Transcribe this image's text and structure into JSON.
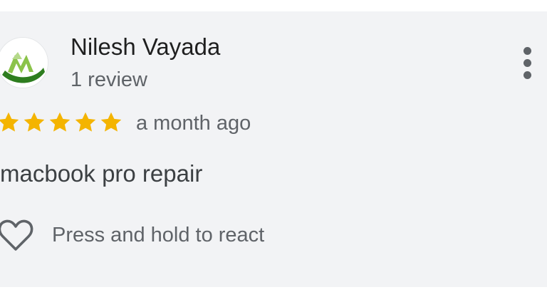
{
  "review": {
    "reviewer_name": "Nilesh Vayada",
    "review_count": "1 review",
    "rating": 5,
    "rating_max": 5,
    "time_ago": "a month ago",
    "text": "macbook pro repair",
    "react_label": "Press and hold to react"
  },
  "icons": {
    "star": "star-icon",
    "heart": "heart-outline-icon",
    "more": "more-vertical-icon",
    "avatar": "reviewer-avatar-logo"
  },
  "colors": {
    "star": "#f4b400",
    "card_background": "#f2f3f5",
    "avatar_green": "#2e7d1f",
    "avatar_light_green": "#8bc34a"
  }
}
